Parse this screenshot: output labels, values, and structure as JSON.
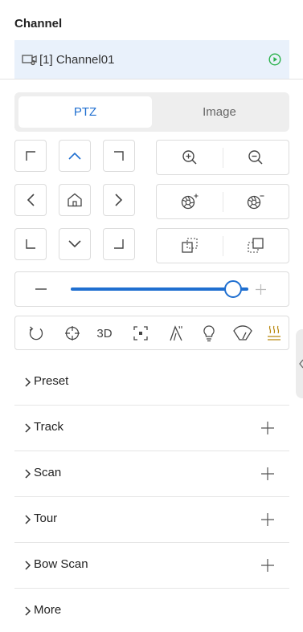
{
  "channel": {
    "heading": "Channel",
    "item_label": "[1] Channel01",
    "camera_icon": "camera-icon",
    "play_icon": "play-circle-icon"
  },
  "tabs": [
    {
      "label": "PTZ",
      "active": true
    },
    {
      "label": "Image",
      "active": false
    }
  ],
  "direction_pad": [
    "up-left",
    "up",
    "up-right",
    "left",
    "home",
    "right",
    "down-left",
    "down",
    "down-right"
  ],
  "lens_controls": [
    [
      "zoom-in-icon",
      "zoom-out-icon"
    ],
    [
      "iris-open-icon",
      "iris-close-icon"
    ],
    [
      "focus-near-icon",
      "focus-far-icon"
    ]
  ],
  "speed_slider": {
    "value_fraction": 1.0
  },
  "functions": {
    "label_3d": "3D",
    "icons": [
      "auto-scan-icon",
      "center-target-icon",
      "3d-position-icon",
      "regional-focus-icon",
      "wiper-icon",
      "light-icon",
      "one-touch-patrol-icon",
      "heater-icon"
    ]
  },
  "sections": [
    {
      "label": "Preset",
      "has_add": false
    },
    {
      "label": "Track",
      "has_add": true
    },
    {
      "label": "Scan",
      "has_add": true
    },
    {
      "label": "Tour",
      "has_add": true
    },
    {
      "label": "Bow Scan",
      "has_add": true
    },
    {
      "label": "More",
      "has_add": false
    }
  ],
  "colors": {
    "accent": "#1f6fd0",
    "play": "#2bb24c",
    "selected_row": "#e9f1fb"
  }
}
